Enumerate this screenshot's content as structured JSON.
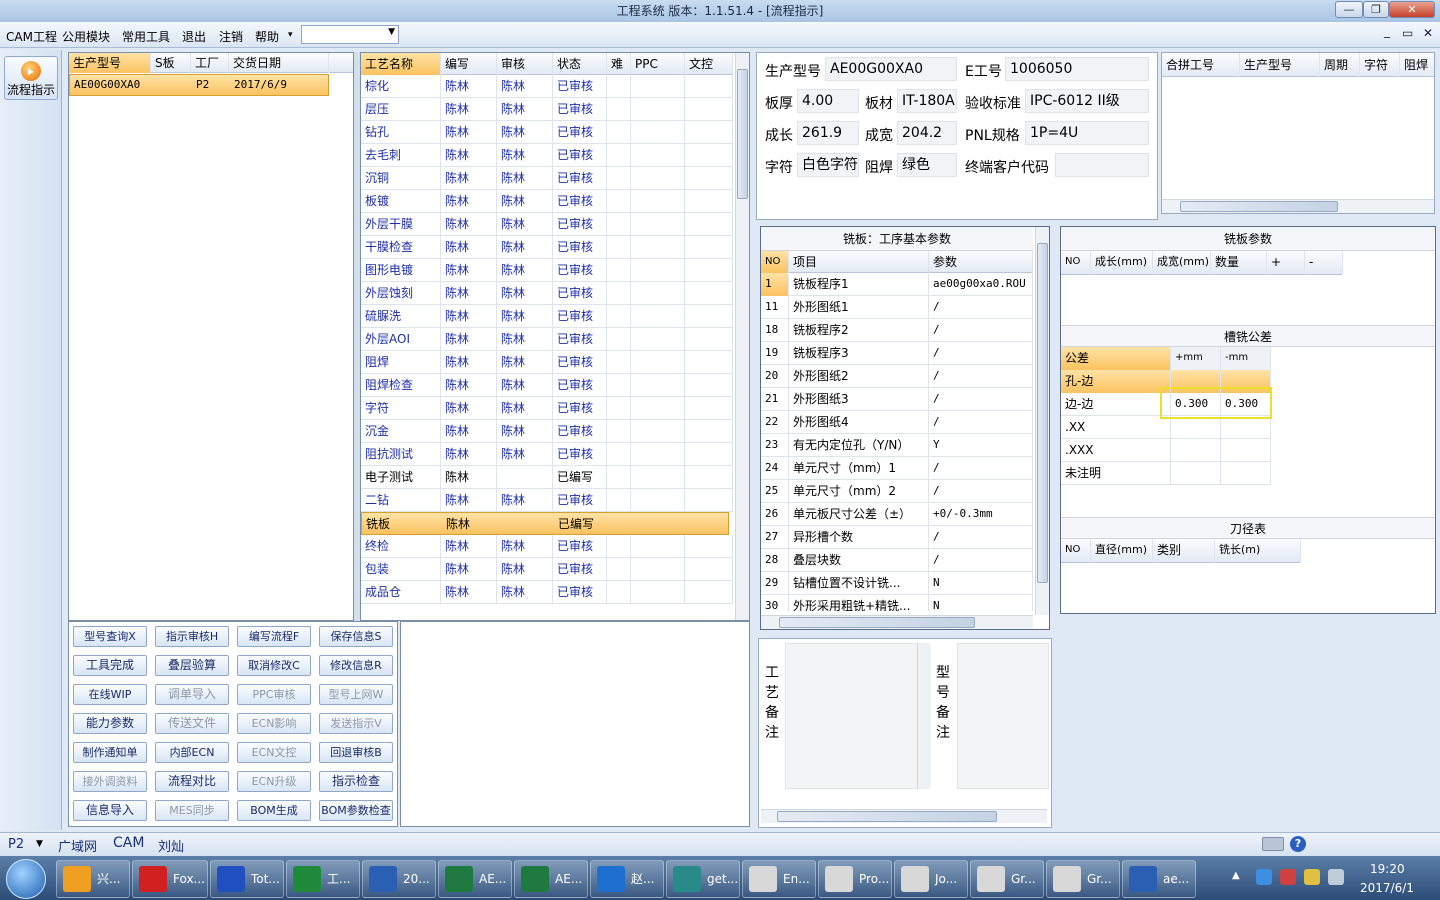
{
  "window": {
    "title": "工程系统   版本：1.1.51.4 - [流程指示]",
    "min": "—",
    "max": "❐",
    "close": "✕",
    "mdi_min": "_",
    "mdi_restore": "▭",
    "mdi_close": "✕"
  },
  "menu": [
    "CAM工程",
    "公用模块",
    "常用工具",
    "退出",
    "注销",
    "帮助"
  ],
  "menu_more": "▾",
  "combo_value": "",
  "left_tool": {
    "label": "流程指示"
  },
  "order_grid": {
    "headers": [
      "生产型号",
      "S板",
      "工厂",
      "交货日期"
    ],
    "rows": [
      [
        "AE00G00XA0",
        "",
        "P2",
        "2017/6/9"
      ]
    ]
  },
  "process_grid": {
    "headers": [
      "工艺名称",
      "编写",
      "审核",
      "状态",
      "难",
      "PPC",
      "文控"
    ],
    "rows": [
      [
        "棕化",
        "陈林",
        "陈林",
        "已审核"
      ],
      [
        "层压",
        "陈林",
        "陈林",
        "已审核"
      ],
      [
        "钻孔",
        "陈林",
        "陈林",
        "已审核"
      ],
      [
        "去毛刺",
        "陈林",
        "陈林",
        "已审核"
      ],
      [
        "沉铜",
        "陈林",
        "陈林",
        "已审核"
      ],
      [
        "板镀",
        "陈林",
        "陈林",
        "已审核"
      ],
      [
        "外层干膜",
        "陈林",
        "陈林",
        "已审核"
      ],
      [
        "干膜检查",
        "陈林",
        "陈林",
        "已审核"
      ],
      [
        "图形电镀",
        "陈林",
        "陈林",
        "已审核"
      ],
      [
        "外层蚀刻",
        "陈林",
        "陈林",
        "已审核"
      ],
      [
        "硫脲洗",
        "陈林",
        "陈林",
        "已审核"
      ],
      [
        "外层AOI",
        "陈林",
        "陈林",
        "已审核"
      ],
      [
        "阻焊",
        "陈林",
        "陈林",
        "已审核"
      ],
      [
        "阻焊检查",
        "陈林",
        "陈林",
        "已审核"
      ],
      [
        "字符",
        "陈林",
        "陈林",
        "已审核"
      ],
      [
        "沉金",
        "陈林",
        "陈林",
        "已审核"
      ],
      [
        "阻抗测试",
        "陈林",
        "陈林",
        "已审核"
      ],
      [
        "电子测试",
        "陈林",
        "",
        "已编写"
      ],
      [
        "二钻",
        "陈林",
        "陈林",
        "已审核"
      ],
      [
        "铣板",
        "陈林",
        "",
        "已编写"
      ],
      [
        "终检",
        "陈林",
        "陈林",
        "已审核"
      ],
      [
        "包装",
        "陈林",
        "陈林",
        "已审核"
      ],
      [
        "成品仓",
        "陈林",
        "陈林",
        "已审核"
      ]
    ]
  },
  "buttons": [
    [
      "型号查询X",
      "指示审核H",
      "编写流程F",
      "保存信息S"
    ],
    [
      "工具完成",
      "叠层验算",
      "取消修改C",
      "修改信息R"
    ],
    [
      "在线WIP",
      "调单导入",
      "PPC审核",
      "型号上网W"
    ],
    [
      "能力参数",
      "传送文件",
      "ECN影响",
      "发送指示V"
    ],
    [
      "制作通知单",
      "内部ECN",
      "ECN文控",
      "回退审核B"
    ],
    [
      "接外调资料",
      "流程对比",
      "ECN升级",
      "指示检查"
    ],
    [
      "信息导入",
      "MES同步",
      "BOM生成",
      "BOM参数检查"
    ]
  ],
  "info": {
    "prod_model_label": "生产型号",
    "prod_model": "AE00G00XA0",
    "e_no_label": "E工号",
    "e_no": "1006050",
    "thick_label": "板厚",
    "thick": "4.00",
    "material_label": "板材",
    "material": "IT-180A",
    "std_label": "验收标准",
    "std": "IPC-6012 II级",
    "len_label": "成长",
    "len": "261.9",
    "wid_label": "成宽",
    "wid": "204.2",
    "pnl_label": "PNL规格",
    "pnl": "1P=4U",
    "char_label": "字符",
    "char": "白色字符",
    "mask_label": "阻焊",
    "mask": "绿色",
    "cust_label": "终端客户代码",
    "cust": ""
  },
  "merge_grid": {
    "headers": [
      "合拼工号",
      "生产型号",
      "周期",
      "字符",
      "阻焊"
    ]
  },
  "mill_params": {
    "title": "铣板：工序基本参数",
    "headers": [
      "NO",
      "项目",
      "参数"
    ],
    "rows": [
      [
        "1",
        "铣板程序1",
        "ae00g00xa0.ROU"
      ],
      [
        "11",
        "外形图纸1",
        "/"
      ],
      [
        "18",
        "铣板程序2",
        "/"
      ],
      [
        "19",
        "铣板程序3",
        "/"
      ],
      [
        "20",
        "外形图纸2",
        "/"
      ],
      [
        "21",
        "外形图纸3",
        "/"
      ],
      [
        "22",
        "外形图纸4",
        "/"
      ],
      [
        "23",
        "有无内定位孔（Y/N）",
        "Y"
      ],
      [
        "24",
        "单元尺寸（mm）1",
        "/"
      ],
      [
        "25",
        "单元尺寸（mm）2",
        "/"
      ],
      [
        "26",
        "单元板尺寸公差（±）",
        "+0/-0.3mm"
      ],
      [
        "27",
        "异形槽个数",
        "/"
      ],
      [
        "28",
        "叠层块数",
        "/"
      ],
      [
        "29",
        "钻槽位置不设计铣...",
        "N"
      ],
      [
        "30",
        "外形采用粗铣+精铣...",
        "N"
      ]
    ]
  },
  "mill_board": {
    "title": "铣板参数",
    "headers": [
      "NO",
      "成长(mm)",
      "成宽(mm)",
      "数量",
      "+",
      "-"
    ]
  },
  "slot_tol": {
    "title": "槽铣公差",
    "headers": [
      "公差",
      "+mm",
      "-mm"
    ],
    "rows": [
      [
        "孔-边",
        "",
        ""
      ],
      [
        "边-边",
        "0.300",
        "0.300"
      ],
      [
        ".XX",
        "",
        ""
      ],
      [
        ".XXX",
        "",
        ""
      ],
      [
        "未注明",
        "",
        ""
      ]
    ]
  },
  "tool_table": {
    "title": "刀径表",
    "headers": [
      "NO",
      "直径(mm)",
      "类别",
      "铣长(m)"
    ]
  },
  "notes": {
    "process_label": "工艺备注",
    "model_label": "型号备注"
  },
  "status": {
    "factory": "P2",
    "links": [
      "广域网",
      "CAM",
      "刘灿"
    ]
  },
  "taskbar": {
    "items": [
      {
        "label": "兴...",
        "color": "#f0a020"
      },
      {
        "label": "Fox...",
        "color": "#d02020"
      },
      {
        "label": "Tot...",
        "color": "#2050c0"
      },
      {
        "label": "工...",
        "color": "#1f8a3a"
      },
      {
        "label": "20...",
        "color": "#2b5fb3"
      },
      {
        "label": "AE...",
        "color": "#1e7a3e"
      },
      {
        "label": "AE...",
        "color": "#1e7a3e"
      },
      {
        "label": "赵...",
        "color": "#1f6fd0"
      },
      {
        "label": "get...",
        "color": "#2a8a8a"
      },
      {
        "label": "En...",
        "color": "#d8d8d8"
      },
      {
        "label": "Pro...",
        "color": "#d8d8d8"
      },
      {
        "label": "Jo...",
        "color": "#d8d8d8"
      },
      {
        "label": "Gr...",
        "color": "#d8d8d8"
      },
      {
        "label": "Gr...",
        "color": "#d8d8d8"
      },
      {
        "label": "ae...",
        "color": "#2b5fb3"
      }
    ],
    "time": "19:20",
    "date": "2017/6/1"
  },
  "icons": {
    "start": "windows-start-icon",
    "help": "help-icon",
    "keyboard": "keyboard-icon",
    "flow": "flow-indicator-icon"
  }
}
